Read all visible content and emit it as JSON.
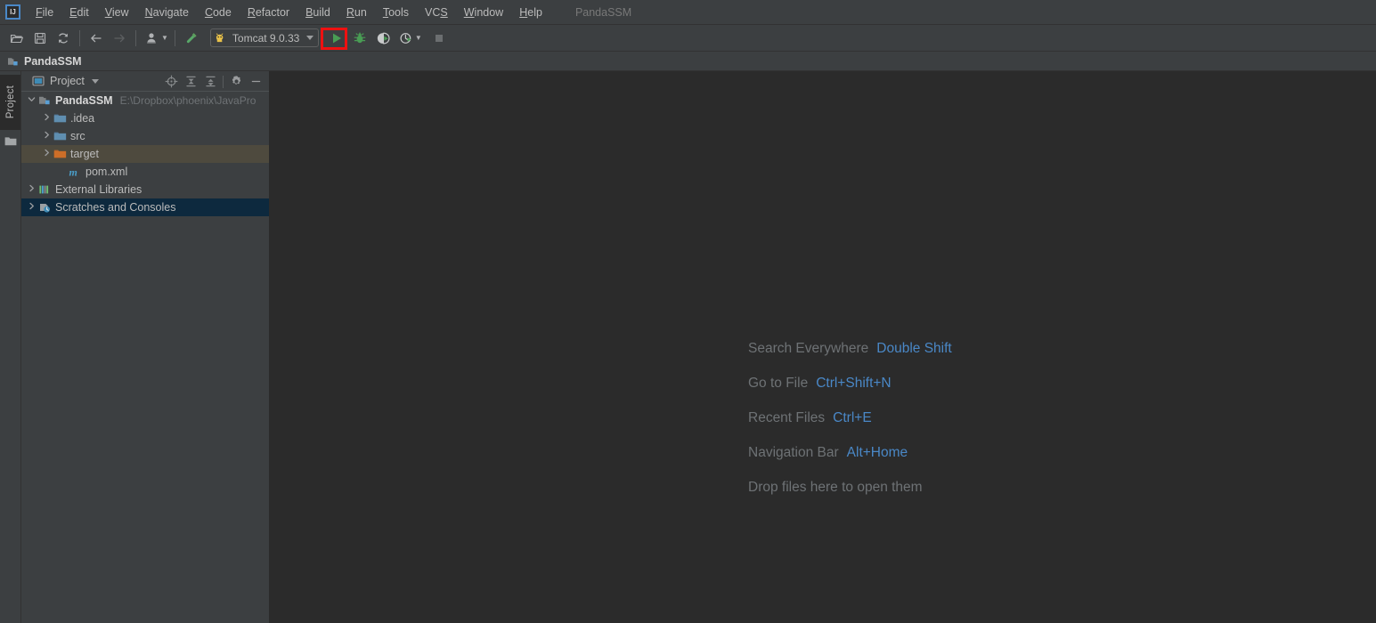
{
  "window": {
    "title": "PandaSSM",
    "logo_icon": "intellij-idea-logo"
  },
  "menubar": {
    "items": [
      {
        "label": "File",
        "mnemonic": "F"
      },
      {
        "label": "Edit",
        "mnemonic": "E"
      },
      {
        "label": "View",
        "mnemonic": "V"
      },
      {
        "label": "Navigate",
        "mnemonic": "N"
      },
      {
        "label": "Code",
        "mnemonic": "C"
      },
      {
        "label": "Refactor",
        "mnemonic": "R"
      },
      {
        "label": "Build",
        "mnemonic": "B"
      },
      {
        "label": "Run",
        "mnemonic": "R"
      },
      {
        "label": "Tools",
        "mnemonic": "T"
      },
      {
        "label": "VCS",
        "mnemonic": "S"
      },
      {
        "label": "Window",
        "mnemonic": "W"
      },
      {
        "label": "Help",
        "mnemonic": "H"
      }
    ]
  },
  "toolbar": {
    "buttons": [
      {
        "name": "open-file-icon",
        "tooltip": "Open"
      },
      {
        "name": "save-all-icon",
        "tooltip": "Save All"
      },
      {
        "name": "sync-refresh-icon",
        "tooltip": "Synchronize"
      },
      {
        "name": "back-arrow-icon",
        "tooltip": "Back"
      },
      {
        "name": "forward-arrow-icon",
        "tooltip": "Forward"
      },
      {
        "name": "profile-update-icon",
        "tooltip": "Update Project"
      },
      {
        "name": "build-hammer-icon",
        "tooltip": "Build Project"
      }
    ],
    "run_config": {
      "name": "run-configuration-selector",
      "label": "Tomcat 9.0.33",
      "icon": "tomcat-cat-icon"
    },
    "run_button": {
      "name": "run-button",
      "icon": "green-play-triangle",
      "color": "#499c54"
    },
    "debug_button": {
      "name": "debug-button",
      "icon": "green-bug-icon",
      "color": "#499c54"
    },
    "run_coverage_button": {
      "name": "run-with-coverage-button",
      "icon": "coverage-icon"
    },
    "profiler_button": {
      "name": "profiler-button",
      "icon": "profiler-clock-icon"
    },
    "stop_button": {
      "name": "stop-button",
      "icon": "stop-square-icon"
    },
    "highlight": {
      "name": "red-annotation-box",
      "color": "#ee1111"
    }
  },
  "navbar": {
    "crumb": "PandaSSM",
    "icon": "module-icon"
  },
  "stripe": {
    "tab_label": "Project",
    "folder_icon": "folder-icon"
  },
  "project_panel": {
    "title": "Project",
    "title_icon": "project-view-icon",
    "actions": [
      {
        "name": "locate-in-tree-icon",
        "tooltip": "Select Opened File"
      },
      {
        "name": "expand-all-icon",
        "tooltip": "Expand All"
      },
      {
        "name": "collapse-all-icon",
        "tooltip": "Collapse All"
      },
      {
        "name": "settings-gear-icon",
        "tooltip": "Settings"
      },
      {
        "name": "hide-minimize-icon",
        "tooltip": "Hide"
      }
    ],
    "tree": [
      {
        "label": "PandaSSM",
        "path": "E:\\Dropbox\\phoenix\\JavaPro",
        "icon": "module-icon",
        "twisty": "expanded",
        "indent": 0,
        "bold": true,
        "state": "normal"
      },
      {
        "label": ".idea",
        "path": "",
        "icon": "folder-blue-icon",
        "twisty": "collapsed",
        "indent": 1,
        "bold": false,
        "state": "normal"
      },
      {
        "label": "src",
        "path": "",
        "icon": "folder-blue-icon",
        "twisty": "collapsed",
        "indent": 1,
        "bold": false,
        "state": "normal"
      },
      {
        "label": "target",
        "path": "",
        "icon": "folder-orange-icon",
        "twisty": "collapsed",
        "indent": 1,
        "bold": false,
        "state": "hover"
      },
      {
        "label": "pom.xml",
        "path": "",
        "icon": "maven-pom-icon",
        "twisty": "none",
        "indent": 2,
        "bold": false,
        "state": "normal"
      },
      {
        "label": "External Libraries",
        "path": "",
        "icon": "libraries-icon",
        "twisty": "collapsed",
        "indent": 0,
        "bold": false,
        "state": "normal"
      },
      {
        "label": "Scratches and Consoles",
        "path": "",
        "icon": "scratches-icon",
        "twisty": "collapsed",
        "indent": 0,
        "bold": false,
        "state": "selected"
      }
    ]
  },
  "editor": {
    "hints": [
      {
        "action": "Search Everywhere",
        "key": "Double Shift"
      },
      {
        "action": "Go to File",
        "key": "Ctrl+Shift+N"
      },
      {
        "action": "Recent Files",
        "key": "Ctrl+E"
      },
      {
        "action": "Navigation Bar",
        "key": "Alt+Home"
      },
      {
        "action": "Drop files here to open them",
        "key": ""
      }
    ]
  },
  "colors": {
    "window_bg": "#3c3f41",
    "editor_bg": "#2b2b2b",
    "accent_blue": "#4a88c7",
    "text_primary": "#bbbbbb",
    "text_dim": "#6e7275",
    "selection_blue": "#0d293e",
    "hover_olive": "#4e4a3e",
    "run_green": "#499c54",
    "annotation_red": "#ee1111"
  }
}
